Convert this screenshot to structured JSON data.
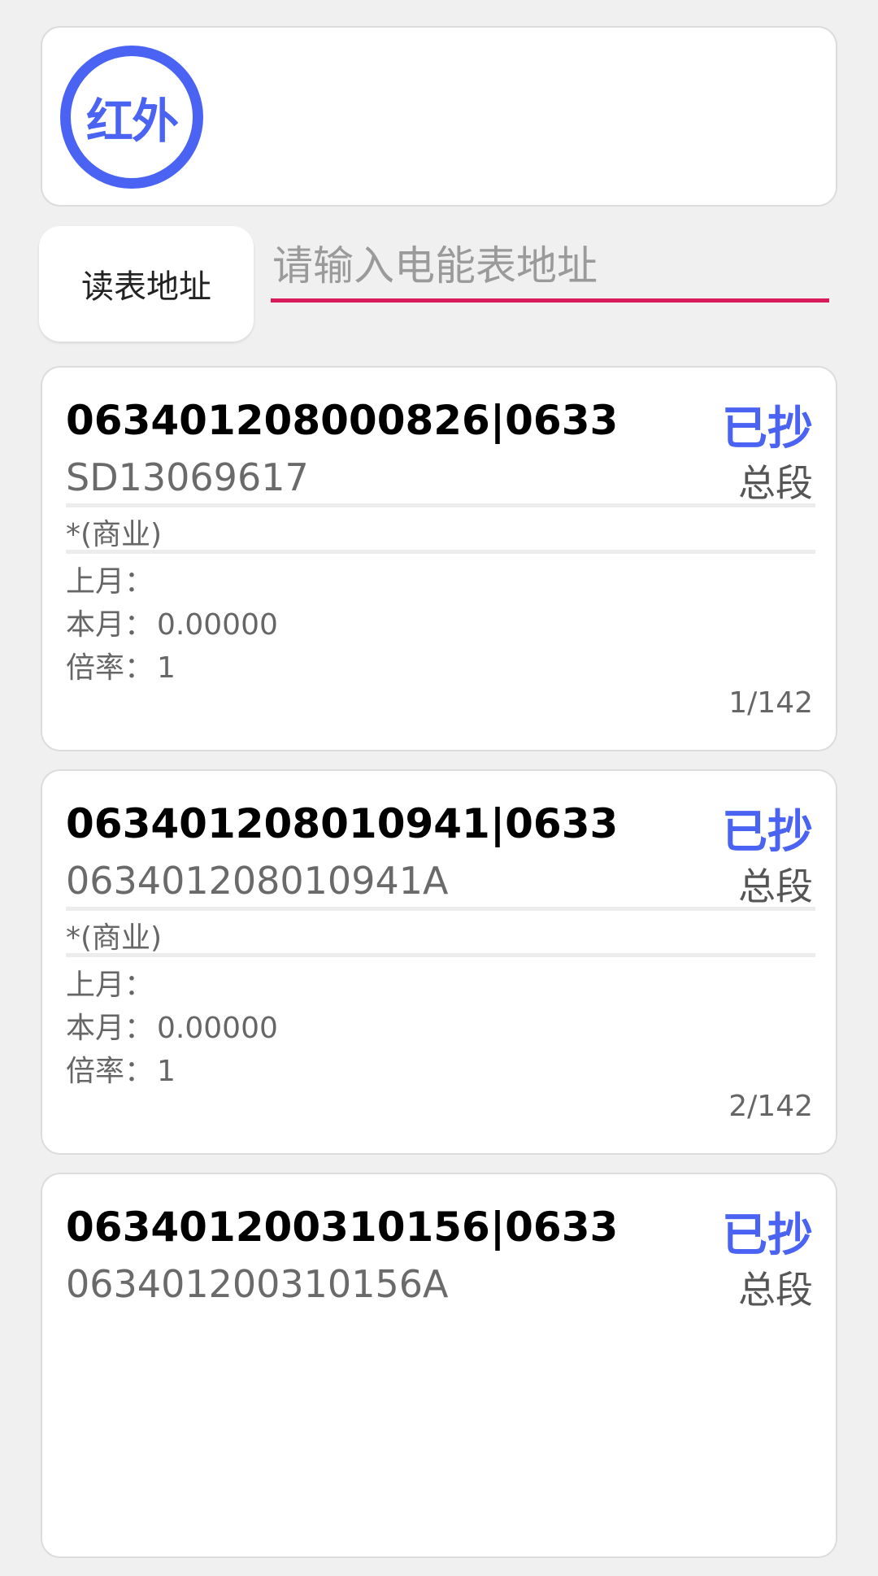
{
  "infrared": {
    "label": "红外"
  },
  "read_address": {
    "button_label": "读表地址",
    "input_value": "",
    "input_placeholder": "请输入电能表地址"
  },
  "meters": [
    {
      "id": "063401208000826|0633",
      "asset_no": "SD13069617",
      "status": "已抄",
      "segment": "总段",
      "category": "*(商业)",
      "last_month_label": "上月：",
      "last_month_value": "",
      "this_month_label": "本月：",
      "this_month_value": "0.00000",
      "rate_label": "倍率：",
      "rate_value": "1",
      "index": "1/142"
    },
    {
      "id": "063401208010941|0633",
      "asset_no": "063401208010941A",
      "status": "已抄",
      "segment": "总段",
      "category": "*(商业)",
      "last_month_label": "上月：",
      "last_month_value": "",
      "this_month_label": "本月：",
      "this_month_value": "0.00000",
      "rate_label": "倍率：",
      "rate_value": "1",
      "index": "2/142"
    },
    {
      "id": "063401200310156|0633",
      "asset_no": "063401200310156A",
      "status": "已抄",
      "segment": "总段"
    }
  ],
  "colors": {
    "accent_blue": "#4a63f2",
    "input_underline": "#d81b5a",
    "background": "#f0f0f0"
  }
}
